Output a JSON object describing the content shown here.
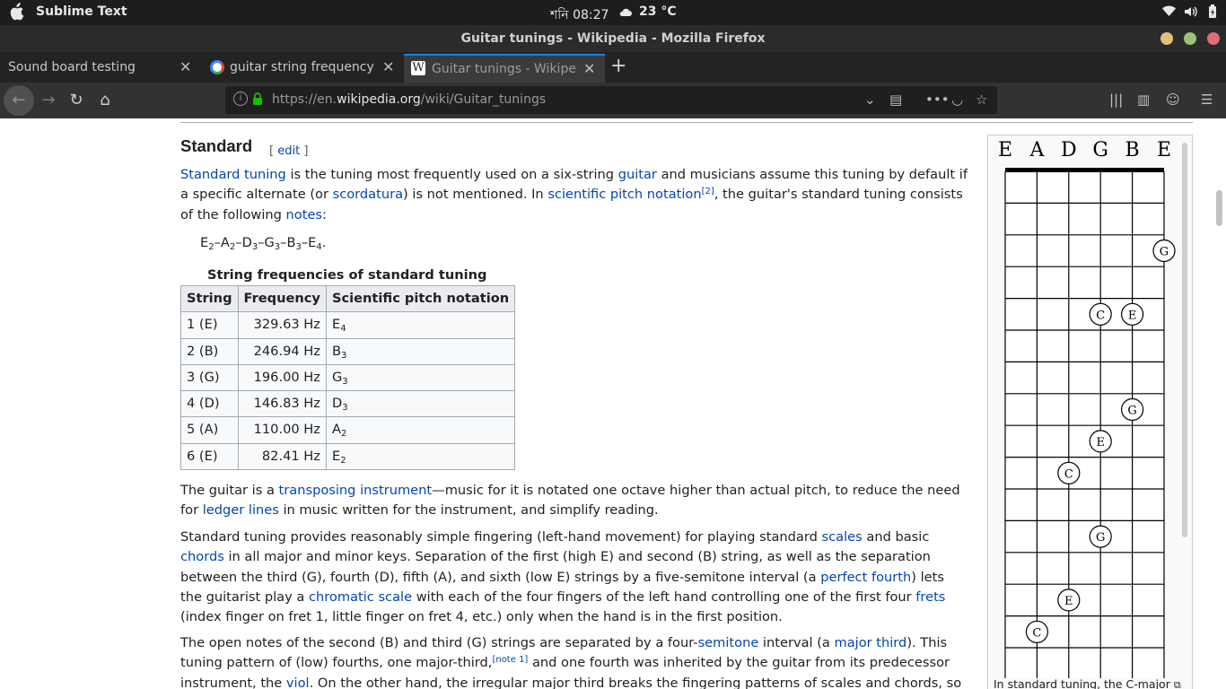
{
  "system": {
    "app_name": "Sublime Text",
    "clock": "শনি 08:27",
    "temperature": "23 °C"
  },
  "window": {
    "title": "Guitar tunings - Wikipedia - Mozilla Firefox"
  },
  "tabs": [
    {
      "label": "Sound board testing"
    },
    {
      "label": "guitar string frequency a"
    },
    {
      "label": "Guitar tunings - Wikipedi"
    }
  ],
  "nav": {
    "url_prefix": "https://en.",
    "url_domain": "wikipedia.org",
    "url_path": "/wiki/Guitar_tunings"
  },
  "article": {
    "heading": "Standard",
    "edit_open": "[",
    "edit_label": "edit",
    "edit_close": "]",
    "p1": {
      "standard_tuning": "Standard tuning",
      "t1": " is the tuning most frequently used on a six-string ",
      "guitar": "guitar",
      "t2": " and musicians assume this tuning by default if a specific alternate (or ",
      "scordatura": "scordatura",
      "t3": ") is not mentioned. In ",
      "spn": "scientific pitch notation",
      "ref": "[2]",
      "t4": ", the guitar's standard tuning consists of the following ",
      "notes": "notes",
      "t5": ":"
    },
    "formula": [
      {
        "n": "E",
        "s": "2"
      },
      {
        "n": "A",
        "s": "2"
      },
      {
        "n": "D",
        "s": "3"
      },
      {
        "n": "G",
        "s": "3"
      },
      {
        "n": "B",
        "s": "3"
      },
      {
        "n": "E",
        "s": "4"
      }
    ],
    "table": {
      "caption": "String frequencies of standard tuning",
      "headers": [
        "String",
        "Frequency",
        "Scientific pitch notation"
      ],
      "rows": [
        {
          "string": "1 (E)",
          "freq": "329.63 Hz",
          "note": "E",
          "oct": "4"
        },
        {
          "string": "2 (B)",
          "freq": "246.94 Hz",
          "note": "B",
          "oct": "3"
        },
        {
          "string": "3 (G)",
          "freq": "196.00 Hz",
          "note": "G",
          "oct": "3"
        },
        {
          "string": "4 (D)",
          "freq": "146.83 Hz",
          "note": "D",
          "oct": "3"
        },
        {
          "string": "5 (A)",
          "freq": "110.00 Hz",
          "note": "A",
          "oct": "2"
        },
        {
          "string": "6 (E)",
          "freq": "82.41 Hz",
          "note": "E",
          "oct": "2"
        }
      ]
    },
    "p2": {
      "t1": "The guitar is a ",
      "transposing": "transposing instrument",
      "t2": "—music for it is notated one octave higher than actual pitch, to reduce the need for ",
      "ledger": "ledger lines",
      "t3": " in music written for the instrument, and simplify reading."
    },
    "p3": {
      "t1": "Standard tuning provides reasonably simple fingering (left-hand movement) for playing standard ",
      "scales": "scales",
      "t2": " and basic ",
      "chords": "chords",
      "t3": " in all major and minor keys. Separation of the first (high E) and second (B) string, as well as the separation between the third (G), fourth (D), fifth (A), and sixth (low E) strings by a five-semitone interval (a ",
      "fourth": "perfect fourth",
      "t4": ") lets the guitarist play a ",
      "chromatic": "chromatic scale",
      "t5": " with each of the four fingers of the left hand controlling one of the first four ",
      "frets": "frets",
      "t6": " (index finger on fret 1, little finger on fret 4, etc.) only when the hand is in the first position."
    },
    "p4": {
      "t1": "The open notes of the second (B) and third (G) strings are separated by a four-",
      "semitone": "semitone",
      "t2": " interval (a ",
      "major_third": "major third",
      "t3": "). This tuning pattern of (low) fourths, one major-third,",
      "note_ref": "[note 1]",
      "t4": " and one fourth was inherited by the guitar from its predecessor instrument, the ",
      "viol": "viol",
      "t5": ". On the other hand, the irregular major third breaks the fingering patterns of scales and chords, so that guitarists"
    }
  },
  "figure": {
    "string_labels": [
      "E",
      "A",
      "D",
      "G",
      "B",
      "E"
    ],
    "dots": [
      {
        "fret": 3,
        "string": 6,
        "note": "G"
      },
      {
        "fret": 5,
        "string": 4,
        "note": "C"
      },
      {
        "fret": 5,
        "string": 5,
        "note": "E"
      },
      {
        "fret": 8,
        "string": 5,
        "note": "G"
      },
      {
        "fret": 9,
        "string": 4,
        "note": "E"
      },
      {
        "fret": 10,
        "string": 3,
        "note": "C"
      },
      {
        "fret": 12,
        "string": 4,
        "note": "G"
      },
      {
        "fret": 14,
        "string": 3,
        "note": "E"
      },
      {
        "fret": 15,
        "string": 2,
        "note": "C"
      }
    ],
    "caption": "In standard tuning, the C-major"
  }
}
